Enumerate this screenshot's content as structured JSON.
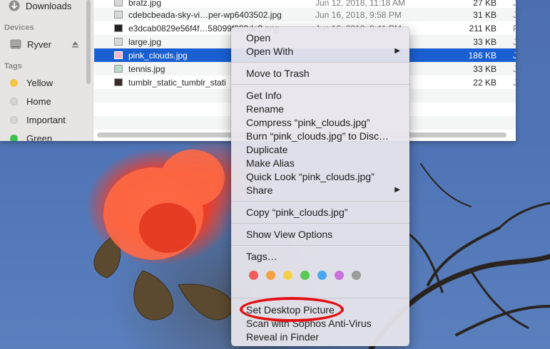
{
  "sidebar": {
    "downloads_label": "Downloads",
    "devices_header": "Devices",
    "device_name": "Ryver",
    "tags_header": "Tags",
    "tags": [
      {
        "label": "Yellow",
        "color": "#f5c542"
      },
      {
        "label": "Home",
        "color": "#d8d6d6"
      },
      {
        "label": "Important",
        "color": "#d8d6d6"
      },
      {
        "label": "Green",
        "color": "#3ec24a"
      }
    ]
  },
  "files": [
    {
      "name": "bratz.jpg",
      "date": "Jun 12, 2018, 11:18 AM",
      "size": "27 KB",
      "kind": "JPEG im"
    },
    {
      "name": "cdebcbeada-sky-vi…per-wp6403502.jpg",
      "date": "Jun 16, 2018, 9:58 PM",
      "size": "31 KB",
      "kind": "JPEG im"
    },
    {
      "name": "e3dcab0829e56f4f…58099f080de9.png",
      "date": "Jun 16, 2018, 9:41 PM",
      "size": "211 KB",
      "kind": "PNG ima"
    },
    {
      "name": "large.jpg",
      "date": "",
      "size": "33 KB",
      "kind": "JPEG im"
    },
    {
      "name": "pink_clouds.jpg",
      "date": "",
      "size": "186 KB",
      "kind": "JPEG im"
    },
    {
      "name": "tennis.jpg",
      "date": "",
      "size": "33 KB",
      "kind": "JPEG im"
    },
    {
      "name": "tumblr_static_tumblr_stati",
      "date": "",
      "size": "22 KB",
      "kind": "JPEG im"
    }
  ],
  "context_menu": {
    "open": "Open",
    "open_with": "Open With",
    "move_to_trash": "Move to Trash",
    "get_info": "Get Info",
    "rename": "Rename",
    "compress": "Compress “pink_clouds.jpg”",
    "burn": "Burn “pink_clouds.jpg” to Disc…",
    "duplicate": "Duplicate",
    "make_alias": "Make Alias",
    "quick_look": "Quick Look “pink_clouds.jpg”",
    "share": "Share",
    "copy": "Copy “pink_clouds.jpg”",
    "show_view_options": "Show View Options",
    "tags": "Tags…",
    "tag_colors": [
      "#f25c5c",
      "#f5a142",
      "#f5cf47",
      "#5bc857",
      "#4aa8f2",
      "#c873d8",
      "#9b9b9b"
    ],
    "set_desktop_picture": "Set Desktop Picture",
    "scan_sophos": "Scan with Sophos Anti-Virus",
    "reveal_in_finder": "Reveal in Finder"
  },
  "colors": {
    "selection": "#1a5fd1",
    "highlight_oval": "#e31013"
  }
}
